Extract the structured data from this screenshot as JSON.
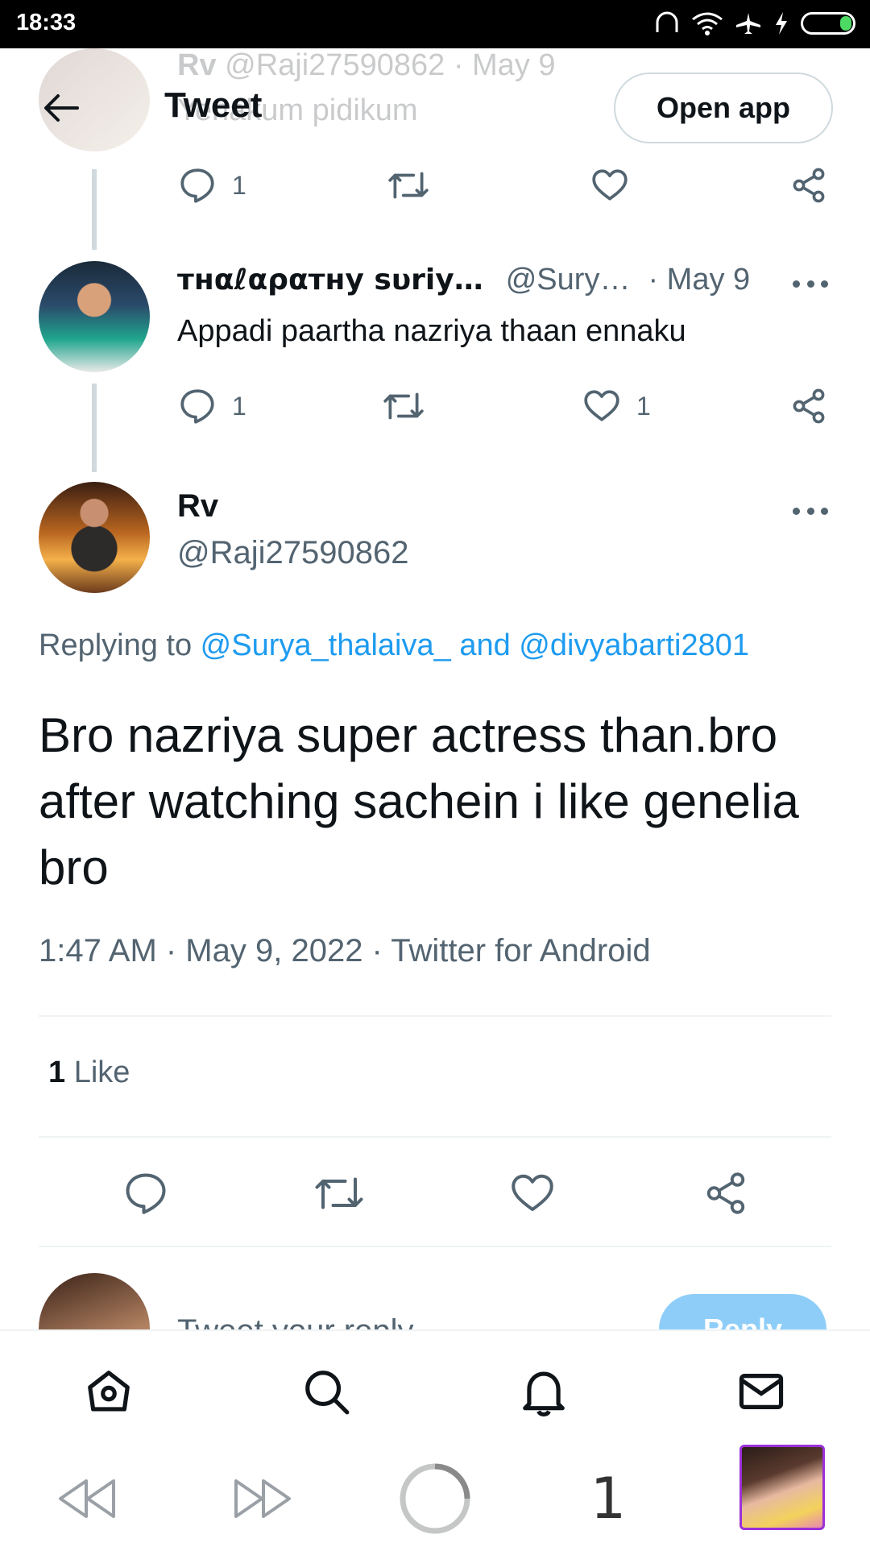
{
  "status_bar": {
    "time": "18:33"
  },
  "header": {
    "title": "Tweet",
    "open_app_label": "Open app"
  },
  "faded_tweet": {
    "name": "Rv",
    "handle": "@Raji27590862",
    "date": "· May 9",
    "text": "Yenakum pidikum",
    "reply_count": "1"
  },
  "reply_tweet": {
    "name": "тнαℓαραтнy ѕυriy…",
    "handle": "@Sury…",
    "date": "· May 9",
    "text": "Appadi paartha nazriya thaan ennaku",
    "reply_count": "1",
    "like_count": "1"
  },
  "main_tweet": {
    "name": "Rv",
    "handle": "@Raji27590862",
    "replying_prefix": "Replying to ",
    "replying_users": "@Surya_thalaiva_ and @divyabarti2801",
    "text": "Bro nazriya super actress than.bro after watching sachein i like genelia bro",
    "meta": "1:47 AM · May 9, 2022 · Twitter for Android",
    "likes_count": "1",
    "likes_label": " Like"
  },
  "compose": {
    "placeholder": "Tweet your reply",
    "reply_label": "Reply"
  },
  "tabs": [
    "home-icon",
    "search-icon",
    "notifications-icon",
    "messages-icon"
  ],
  "browser_nav": {
    "tab_count": "1"
  },
  "colors": {
    "link": "#1d9bf0",
    "muted": "#536471",
    "divider": "#eff3f4",
    "reply_button": "#8ecdf8"
  }
}
